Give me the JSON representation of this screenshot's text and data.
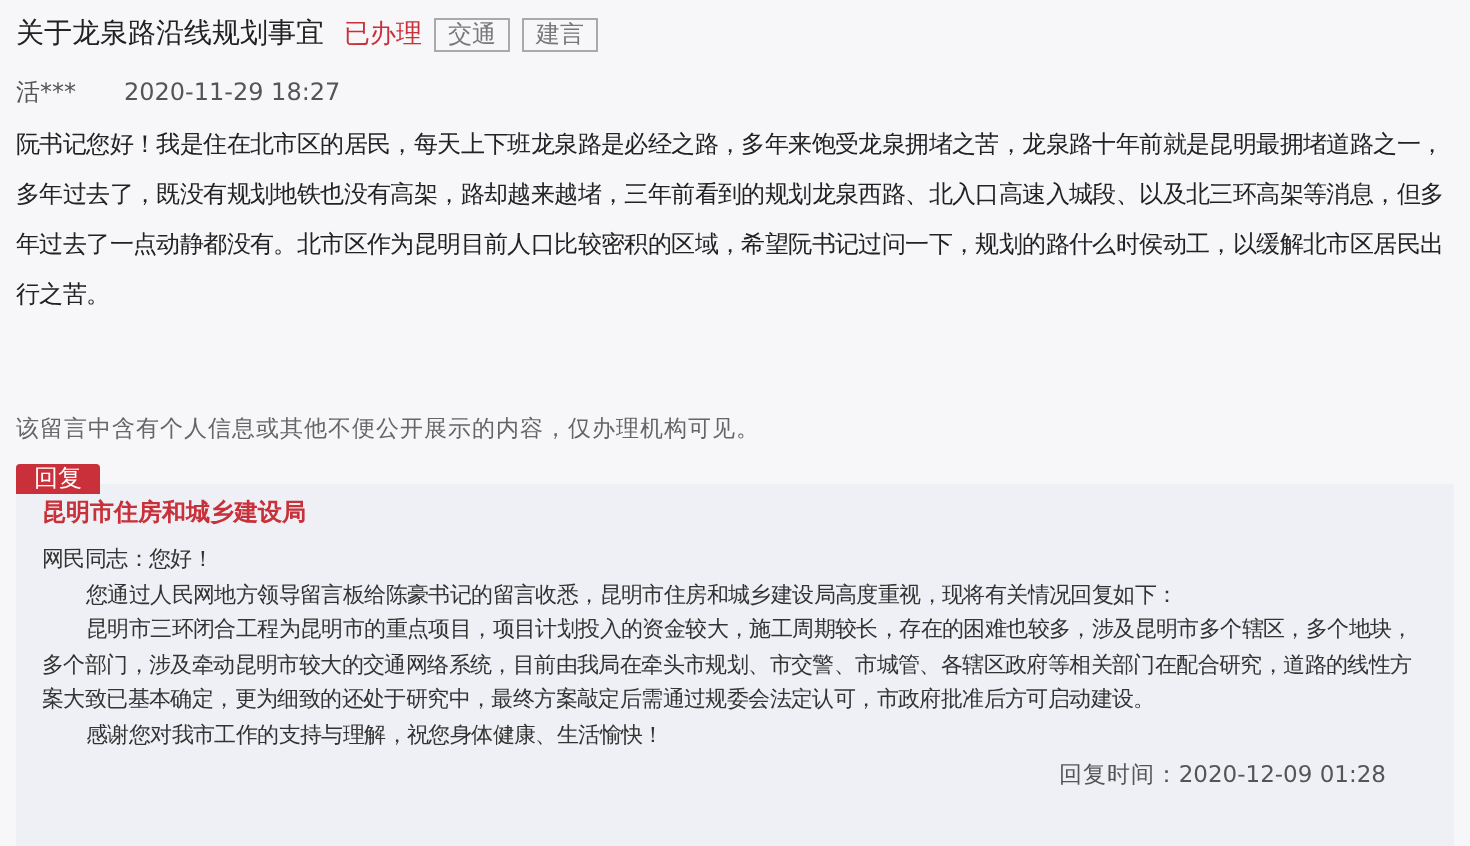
{
  "title": "关于龙泉路沿线规划事宜",
  "status": "已办理",
  "tags": [
    "交通",
    "建言"
  ],
  "author": "活***",
  "date": "2020-11-29 18:27",
  "message": "阮书记您好！我是住在北市区的居民，每天上下班龙泉路是必经之路，多年来饱受龙泉拥堵之苦，龙泉路十年前就是昆明最拥堵道路之一，多年过去了，既没有规划地铁也没有高架，路却越来越堵，三年前看到的规划龙泉西路、北入口高速入城段、以及北三环高架等消息，但多年过去了一点动静都没有。北市区作为昆明目前人口比较密积的区域，希望阮书记过问一下，规划的路什么时侯动工，以缓解北市区居民出行之苦。",
  "privacy_notice": "该留言中含有个人信息或其他不便公开展示的内容，仅办理机构可见。",
  "reply": {
    "label": "回复",
    "organization": "昆明市住房和城乡建设局",
    "paragraphs": [
      {
        "kind": "greeting",
        "text": "网民同志：您好！"
      },
      {
        "kind": "body",
        "text": "您通过人民网地方领导留言板给陈豪书记的留言收悉，昆明市住房和城乡建设局高度重视，现将有关情况回复如下："
      },
      {
        "kind": "body",
        "text": "昆明市三环闭合工程为昆明市的重点项目，项目计划投入的资金较大，施工周期较长，存在的困难也较多，涉及昆明市多个辖区，多个地块，多个部门，涉及牵动昆明市较大的交通网络系统，目前由我局在牵头市规划、市交警、市城管、各辖区政府等相关部门在配合研究，道路的线性方案大致已基本确定，更为细致的还处于研究中，最终方案敲定后需通过规委会法定认可，市政府批准后方可启动建设。"
      },
      {
        "kind": "body",
        "text": "感谢您对我市工作的支持与理解，祝您身体健康、生活愉快！"
      }
    ],
    "time": "回复时间：2020-12-09 01:28"
  }
}
